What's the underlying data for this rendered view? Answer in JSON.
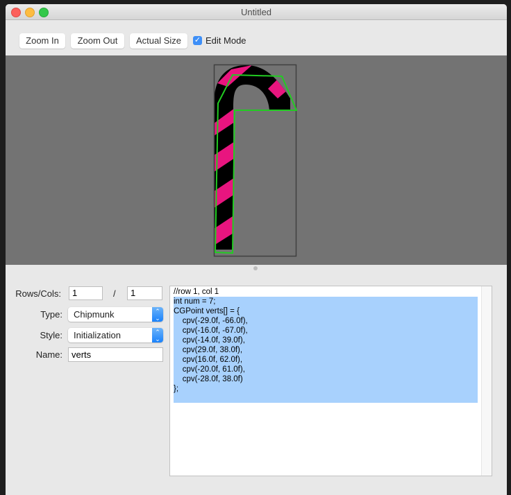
{
  "window": {
    "title": "Untitled"
  },
  "toolbar": {
    "zoom_in_label": "Zoom In",
    "zoom_out_label": "Zoom Out",
    "actual_size_label": "Actual Size",
    "edit_mode_label": "Edit Mode",
    "edit_mode_checked": true
  },
  "canvas": {
    "background": "#737373",
    "sprite": "candy-cane",
    "stripe_color": "#e8157f",
    "outline_color": "#22cc22"
  },
  "form": {
    "rows_cols_label": "Rows/Cols:",
    "rows_value": "1",
    "separator": "/",
    "cols_value": "1",
    "type_label": "Type:",
    "type_value": "Chipmunk",
    "style_label": "Style:",
    "style_value": "Initialization",
    "name_label": "Name:",
    "name_value": "verts"
  },
  "code": {
    "lines": [
      "//row 1, col 1",
      "int num = 7;",
      "CGPoint verts[] = {",
      "    cpv(-29.0f, -66.0f),",
      "    cpv(-16.0f, -67.0f),",
      "    cpv(-14.0f, 39.0f),",
      "    cpv(29.0f, 38.0f),",
      "    cpv(16.0f, 62.0f),",
      "    cpv(-20.0f, 61.0f),",
      "    cpv(-28.0f, 38.0f)",
      "};"
    ]
  }
}
